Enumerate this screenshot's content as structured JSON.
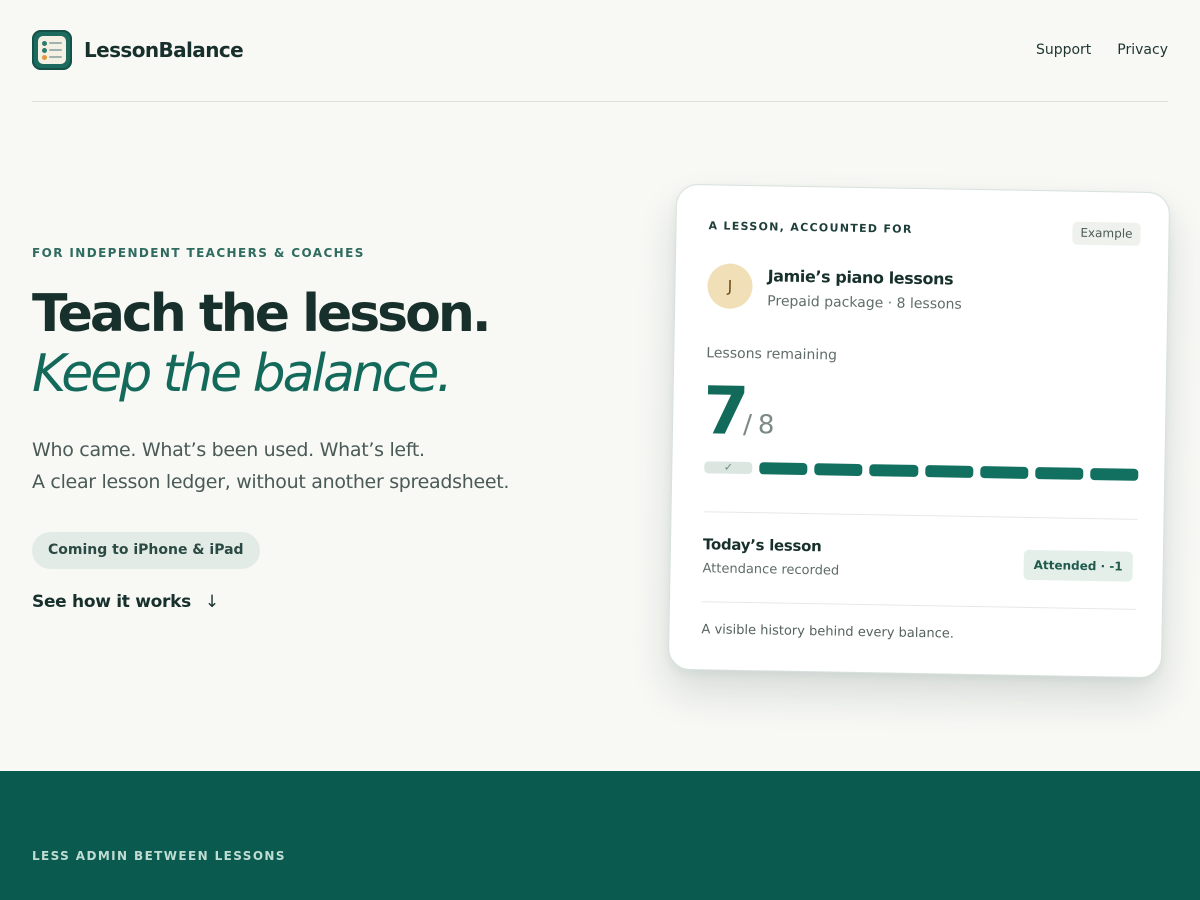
{
  "header": {
    "brand": "LessonBalance",
    "logo_icon": "ledger-app-icon",
    "nav": [
      "Support",
      "Privacy"
    ]
  },
  "hero": {
    "eyebrow": "FOR INDEPENDENT TEACHERS & COACHES",
    "title": "Teach the lesson.",
    "title_accent": "Keep the balance.",
    "lede_line1": "Who came. What’s been used. What’s left.",
    "lede_line2": "A clear lesson ledger, without another spreadsheet.",
    "availability": "Coming to iPhone & iPad",
    "how_link": "See how it works",
    "how_arrow": "↓"
  },
  "card": {
    "eyebrow": "A LESSON, ACCOUNTED FOR",
    "tag": "Example",
    "avatar_initial": "J",
    "student": "Jamie’s piano lessons",
    "package": "Prepaid package · 8 lessons",
    "remaining_label": "Lessons remaining",
    "remaining": "7",
    "total_text": "8",
    "total_slash": "/",
    "lessons_used": 1,
    "lessons_total": 8,
    "used_mark": "✓",
    "today_title": "Today’s lesson",
    "today_status": "Attendance recorded",
    "attended_badge": "Attended · -1",
    "history_note": "A visible history behind every balance."
  },
  "band": {
    "eyebrow": "LESS ADMIN BETWEEN LESSONS"
  },
  "colors": {
    "accent": "#136a5b",
    "band": "#0a5a50",
    "background": "#f8f8f5"
  }
}
